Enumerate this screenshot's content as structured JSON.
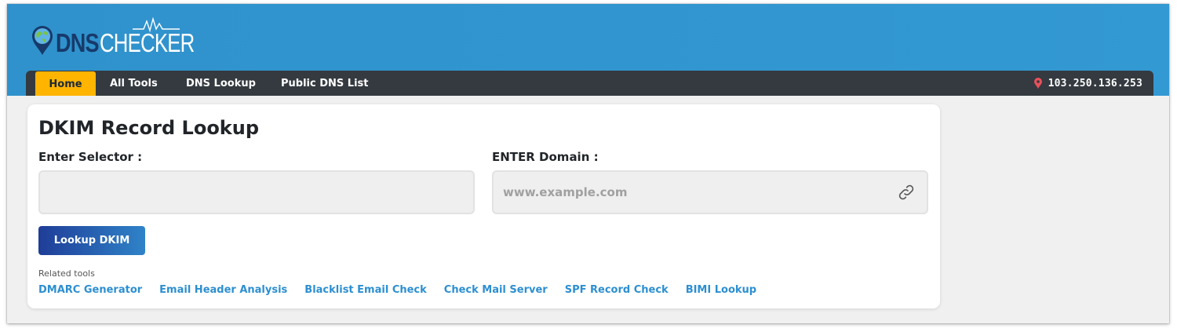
{
  "brand": {
    "dns": "DNS",
    "checker": "CHECKER"
  },
  "nav": {
    "items": [
      {
        "label": "Home",
        "active": true
      },
      {
        "label": "All Tools"
      },
      {
        "label": "DNS Lookup"
      },
      {
        "label": "Public DNS List"
      }
    ],
    "ip_address": "103.250.136.253",
    "ip_icon": "map-pin-icon"
  },
  "page": {
    "title": "DKIM Record Lookup",
    "selector_label": "Enter Selector :",
    "selector_value": "",
    "domain_label": "ENTER Domain :",
    "domain_placeholder": "www.example.com",
    "domain_icon": "link-icon",
    "submit_label": "Lookup DKIM"
  },
  "related": {
    "label": "Related tools",
    "links": [
      "DMARC Generator",
      "Email Header Analysis",
      "Blacklist Email Check",
      "Check Mail Server",
      "SPF Record Check",
      "BIMI Lookup"
    ]
  },
  "colors": {
    "header_blue": "#3399d3",
    "navbar": "#343a40",
    "active_tab": "#ffb400",
    "button_start": "#1f3d98",
    "button_end": "#2f83c8",
    "link": "#2d8fd0",
    "pin": "#e8505b"
  }
}
